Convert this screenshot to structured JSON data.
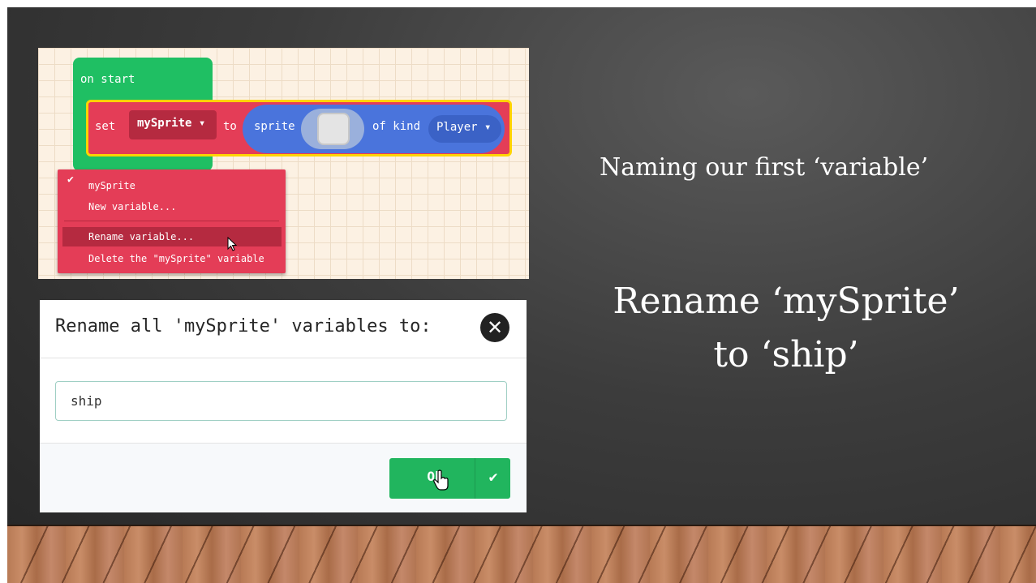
{
  "slide": {
    "caption_line1": "Naming our first ‘variable’",
    "caption_line2a": "Rename ‘mySprite’",
    "caption_line2b": "to ‘ship’"
  },
  "blocks": {
    "on_start": "on start",
    "set": "set",
    "variable": "mySprite ▾",
    "to": "to",
    "sprite": "sprite",
    "of_kind": "of kind",
    "kind": "Player ▾"
  },
  "context_menu": {
    "items": [
      "mySprite",
      "New variable...",
      "Rename variable...",
      "Delete the \"mySprite\" variable"
    ],
    "checked_icon": "check-icon"
  },
  "dialog": {
    "title": "Rename all 'mySprite' variables to:",
    "input_value": "ship",
    "ok_label": "Ok"
  },
  "colors": {
    "block_green": "#1fbf63",
    "block_red": "#e43d57",
    "block_blue": "#4a74dc",
    "ok_green": "#21b55e"
  }
}
